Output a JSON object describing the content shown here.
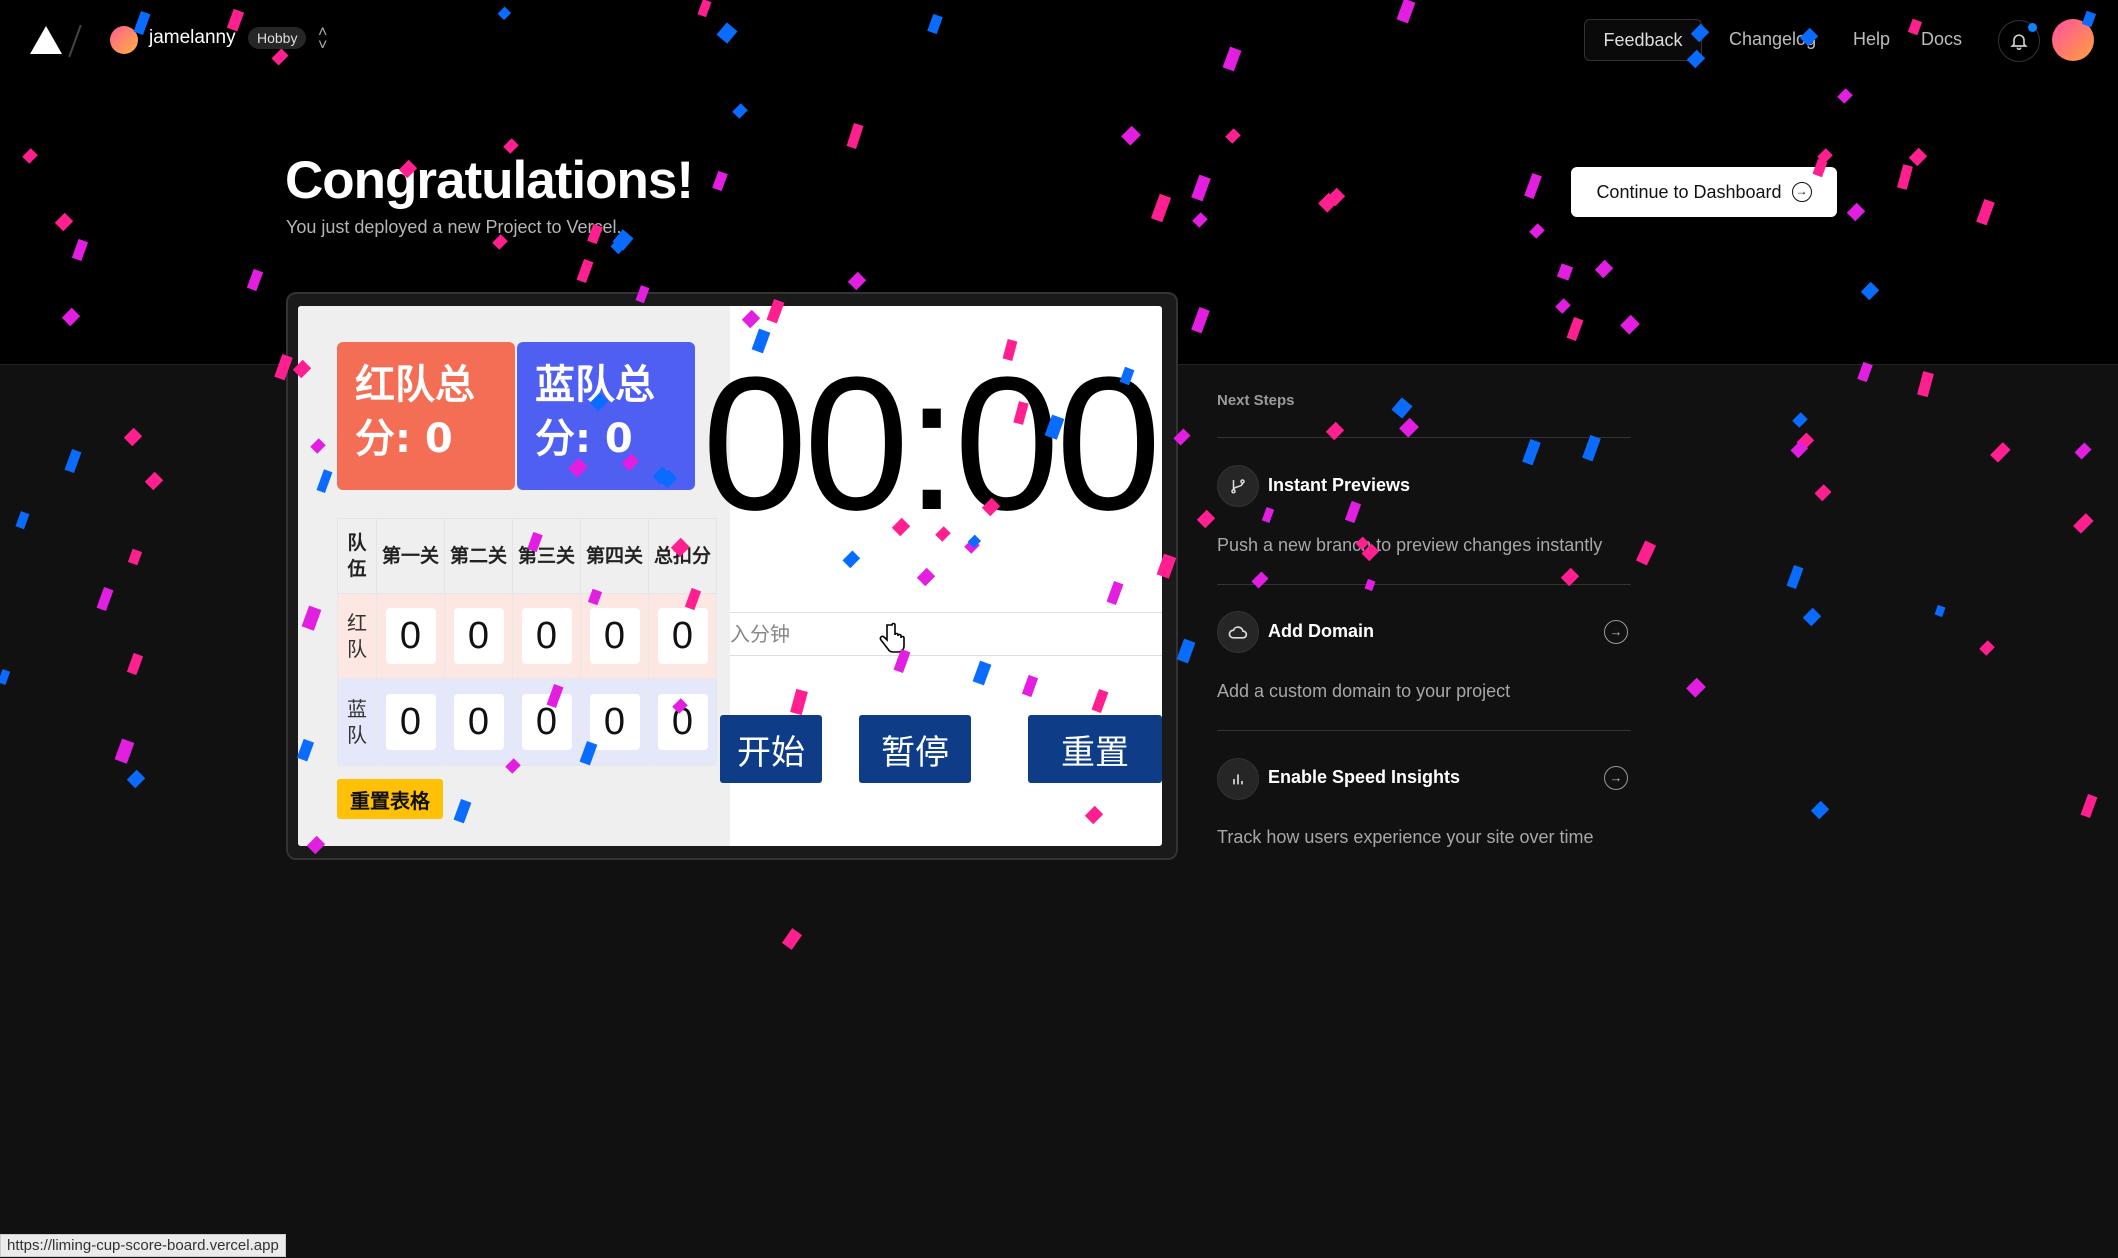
{
  "nav": {
    "username": "jamelanny",
    "plan": "Hobby",
    "feedback": "Feedback",
    "links": [
      "Changelog",
      "Help",
      "Docs"
    ]
  },
  "hero": {
    "title": "Congratulations!",
    "subtitle": "You just deployed a new Project to Vercel.",
    "cta": "Continue to Dashboard"
  },
  "preview": {
    "red_total": "红队总分: 0",
    "blue_total": "蓝队总分: 0",
    "table_headers": [
      "队伍",
      "第一关",
      "第二关",
      "第三关",
      "第四关",
      "总扣分"
    ],
    "rows": [
      {
        "team": "红队",
        "values": [
          "0",
          "0",
          "0",
          "0",
          "0"
        ]
      },
      {
        "team": "蓝队",
        "values": [
          "0",
          "0",
          "0",
          "0",
          "0"
        ]
      }
    ],
    "reset_table": "重置表格",
    "timer": "00:00",
    "minutes_placeholder": "入分钟",
    "buttons": {
      "start": "开始",
      "pause": "暂停",
      "reset": "重置"
    }
  },
  "next_steps": {
    "title": "Next Steps",
    "items": [
      {
        "title": "Instant Previews",
        "desc": "Push a new branch to preview changes instantly",
        "icon": "branch-icon"
      },
      {
        "title": "Add Domain",
        "desc": "Add a custom domain to your project",
        "icon": "cloud-icon"
      },
      {
        "title": "Enable Speed Insights",
        "desc": "Track how users experience your site over time",
        "icon": "bar-chart-icon"
      }
    ]
  },
  "status_url": "https://liming-cup-score-board.vercel.app",
  "colors": {
    "confetti": [
      "#ff1f8e",
      "#0a6cff",
      "#e21fe0"
    ],
    "red_team": "#f36e55",
    "blue_team": "#4f5ff2",
    "timer_button": "#0e3c87",
    "reset_button": "#ffc107"
  }
}
